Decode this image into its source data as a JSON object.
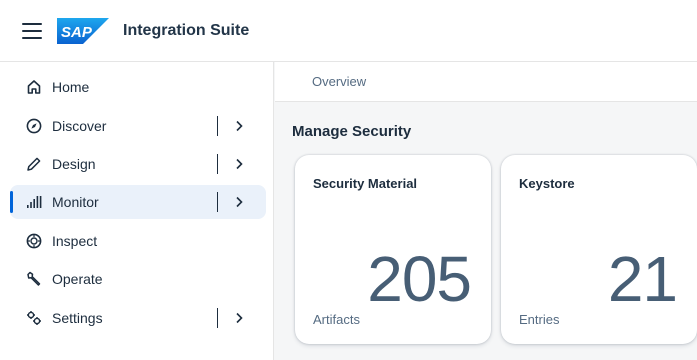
{
  "header": {
    "app_title": "Integration Suite",
    "logo_text": "SAP"
  },
  "sidebar": {
    "items": [
      {
        "label": "Home",
        "icon": "home-icon",
        "expandable": false,
        "selected": false
      },
      {
        "label": "Discover",
        "icon": "compass-icon",
        "expandable": true,
        "selected": false
      },
      {
        "label": "Design",
        "icon": "pencil-icon",
        "expandable": true,
        "selected": false
      },
      {
        "label": "Monitor",
        "icon": "bar-chart-icon",
        "expandable": true,
        "selected": true
      },
      {
        "label": "Inspect",
        "icon": "inspect-icon",
        "expandable": false,
        "selected": false
      },
      {
        "label": "Operate",
        "icon": "wrench-icon",
        "expandable": false,
        "selected": false
      },
      {
        "label": "Settings",
        "icon": "gears-icon",
        "expandable": true,
        "selected": false
      }
    ]
  },
  "main": {
    "tab_label": "Overview",
    "section_title": "Manage Security",
    "tiles": [
      {
        "title": "Security Material",
        "value": "205",
        "unit": "Artifacts"
      },
      {
        "title": "Keystore",
        "value": "21",
        "unit": "Entries"
      }
    ]
  },
  "colors": {
    "accent": "#0064d9",
    "selected_bg": "#eaf1fa",
    "text": "#1d2d3e",
    "kpi_value": "#475e75",
    "sap_blue": "#0070f2"
  }
}
